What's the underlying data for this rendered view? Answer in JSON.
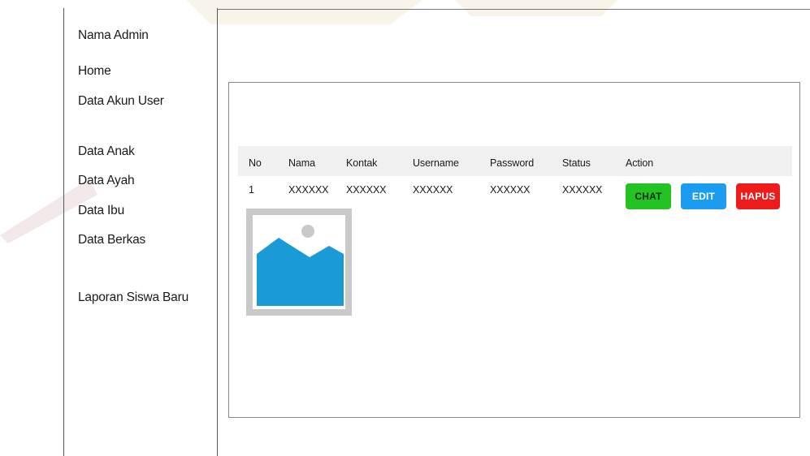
{
  "sidebar": {
    "admin_name": "Nama Admin",
    "items": [
      {
        "label": "Home"
      },
      {
        "label": "Data Akun User"
      },
      {
        "label": "Data Anak"
      },
      {
        "label": "Data Ayah"
      },
      {
        "label": "Data Ibu"
      },
      {
        "label": "Data Berkas"
      },
      {
        "label": "Laporan Siswa Baru"
      }
    ]
  },
  "table": {
    "headers": [
      "No",
      "Nama",
      "Kontak",
      "Username",
      "Password",
      "Status",
      "Action"
    ],
    "rows": [
      {
        "no": "1",
        "nama": "XXXXXX",
        "kontak": "XXXXXX",
        "username": "XXXXXX",
        "password": "XXXXXX",
        "status": "XXXXXX"
      }
    ],
    "actions": {
      "chat": "CHAT",
      "edit": "EDIT",
      "hapus": "HAPUS"
    }
  },
  "image_placeholder": {
    "icon": "image-placeholder-icon"
  },
  "colors": {
    "chat": "#22c322",
    "edit": "#1c9cf0",
    "hapus": "#ee1b1b",
    "header_bg": "#f0f0f0",
    "image_blue": "#1a9ad6"
  }
}
